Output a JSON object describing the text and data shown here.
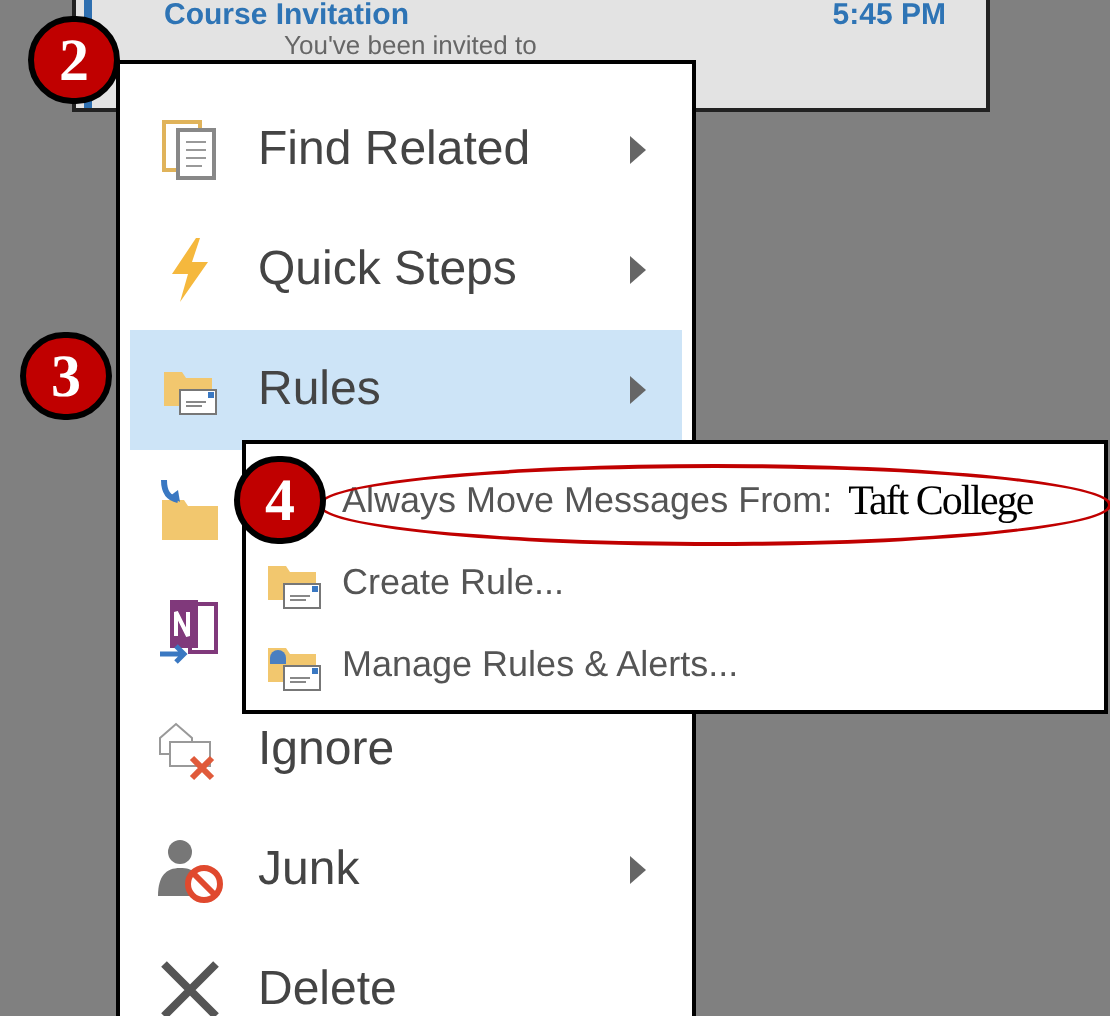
{
  "message": {
    "subject": "Course Invitation",
    "time": "5:45 PM",
    "preview": "You've been invited to"
  },
  "context_menu": {
    "items": [
      {
        "kind": "text",
        "label": "Find Related",
        "submenu": true,
        "selected": false
      },
      {
        "kind": "text",
        "label": "Quick Steps",
        "submenu": true,
        "selected": false
      },
      {
        "kind": "text",
        "label": "Rules",
        "submenu": true,
        "selected": true
      },
      {
        "kind": "covered",
        "selected": false
      },
      {
        "kind": "covered",
        "selected": false
      },
      {
        "kind": "text",
        "label": "Ignore",
        "submenu": false,
        "selected": false
      },
      {
        "kind": "text",
        "label": "Junk",
        "submenu": true,
        "selected": false
      },
      {
        "kind": "text",
        "label": "Delete",
        "submenu": false,
        "selected": false
      }
    ]
  },
  "rules_submenu": {
    "items": [
      {
        "label": "Always Move Messages From:",
        "sender": "Taft College",
        "circled": true
      },
      {
        "label": "Create Rule...",
        "circled": false
      },
      {
        "label": "Manage Rules & Alerts...",
        "circled": false
      }
    ]
  },
  "step_badges": [
    "2",
    "3",
    "4"
  ]
}
